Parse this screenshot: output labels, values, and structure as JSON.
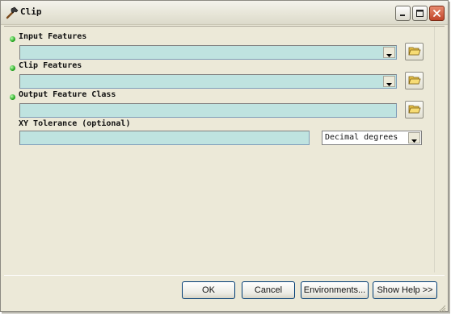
{
  "window": {
    "title": "Clip",
    "title_icon": "hammer-tool-icon",
    "controls": [
      "minimize-icon",
      "maximize-icon",
      "close-icon"
    ]
  },
  "form": {
    "input_features": {
      "label": "Input Features",
      "value": "",
      "required": true
    },
    "clip_features": {
      "label": "Clip Features",
      "value": "",
      "required": true
    },
    "output_feature_class": {
      "label": "Output Feature Class",
      "value": "",
      "required": true
    },
    "xy_tolerance": {
      "label": "XY Tolerance (optional)",
      "value": ""
    },
    "tolerance_units": {
      "selected": "Decimal degrees"
    }
  },
  "buttons": {
    "ok": "OK",
    "cancel": "Cancel",
    "environments": "Environments...",
    "show_help": "Show Help >>"
  },
  "colors": {
    "field_bg": "#bfe3e0",
    "required_dot": "#1fa31a",
    "dialog_bg": "#ece9d8"
  }
}
